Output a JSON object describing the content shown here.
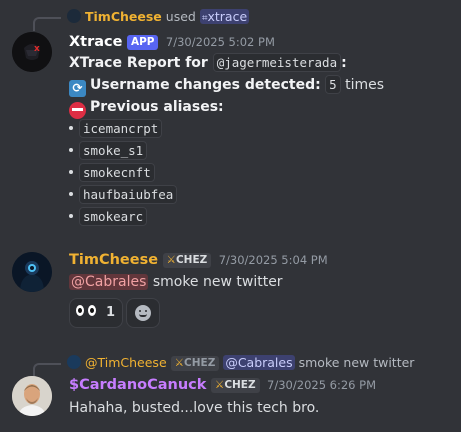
{
  "msg1": {
    "reply_context": {
      "user": "TimCheese",
      "used_text": "used",
      "command": "xtrace",
      "command_icon": "slash-command-icon"
    },
    "author": "Xtrace",
    "app_badge": "APP",
    "timestamp": "7/30/2025 5:02 PM",
    "report_prefix": "XTrace Report for",
    "report_mention": "@jagermeisterada",
    "report_suffix": ":",
    "username_changes_label": "Username changes detected:",
    "username_changes_count": "5",
    "username_changes_unit": "times",
    "aliases_label": "Previous aliases:",
    "aliases": [
      "icemancrpt",
      "smoke_s1",
      "smokecnft",
      "haufbaiubfea",
      "smokearc"
    ]
  },
  "msg2": {
    "author": "TimCheese",
    "author_color": "#f0b232",
    "tag": "CHEZ",
    "timestamp": "7/30/2025 5:04 PM",
    "mention": "@Cabrales",
    "text": "smoke new twitter",
    "reactions": [
      {
        "emoji": "eyes-emoji",
        "count": "1"
      }
    ],
    "add_reaction_icon": "add-reaction-icon"
  },
  "msg3": {
    "reply_context": {
      "user": "@TimCheese",
      "tag": "CHEZ",
      "mention": "@Cabrales",
      "text": "smoke new twitter"
    },
    "author": "$CardanoCanuck",
    "author_color": "#c77dff",
    "tag": "CHEZ",
    "timestamp": "7/30/2025 6:26 PM",
    "text": "Hahaha, busted...love this tech bro."
  },
  "colors": {
    "background": "#313338",
    "text": "#dbdee1",
    "timestamp": "#949ba4",
    "blurple": "#5865f2",
    "mention_red": "#f23f42"
  }
}
